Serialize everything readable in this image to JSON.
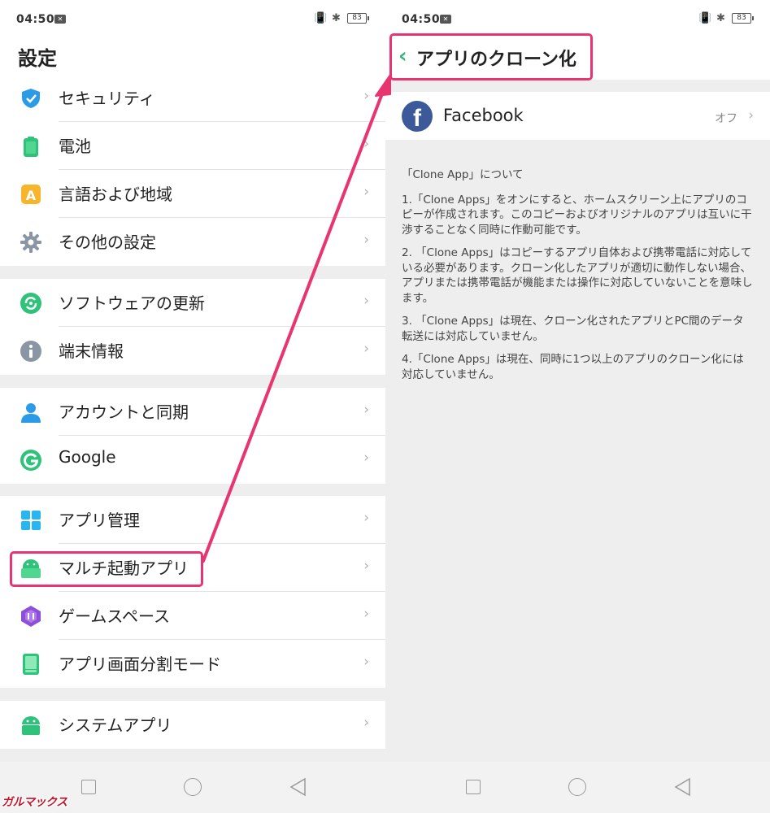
{
  "left": {
    "status": {
      "time": "04:50",
      "battery": "83"
    },
    "title": "設定",
    "sections": [
      {
        "items": [
          {
            "label": "セキュリティ",
            "icon": "shield-icon"
          },
          {
            "label": "電池",
            "icon": "battery-icon"
          },
          {
            "label": "言語および地域",
            "icon": "language-icon"
          },
          {
            "label": "その他の設定",
            "icon": "gear-icon"
          }
        ]
      },
      {
        "items": [
          {
            "label": "ソフトウェアの更新",
            "icon": "update-icon"
          },
          {
            "label": "端末情報",
            "icon": "info-icon"
          }
        ]
      },
      {
        "items": [
          {
            "label": "アカウントと同期",
            "icon": "account-icon"
          },
          {
            "label": "Google",
            "icon": "google-icon"
          }
        ]
      },
      {
        "items": [
          {
            "label": "アプリ管理",
            "icon": "app-grid-icon"
          },
          {
            "label": "マルチ起動アプリ",
            "icon": "android-clone-icon"
          },
          {
            "label": "ゲームスペース",
            "icon": "game-space-icon"
          },
          {
            "label": "アプリ画面分割モード",
            "icon": "split-screen-icon"
          }
        ]
      },
      {
        "items": [
          {
            "label": "システムアプリ",
            "icon": "android-icon"
          }
        ]
      }
    ],
    "chevron": "›"
  },
  "right": {
    "status": {
      "time": "04:50",
      "battery": "83"
    },
    "title": "アプリのクローン化",
    "back_glyph": "‹",
    "app": {
      "name": "Facebook",
      "state": "オフ",
      "icon": "facebook-icon",
      "icon_glyph": "f"
    },
    "info_heading": "「Clone App」について",
    "info_paragraphs": [
      "1.「Clone Apps」をオンにすると、ホームスクリーン上にアプリのコピーが作成されます。このコピーおよびオリジナルのアプリは互いに干渉することなく同時に作動可能です。",
      "2. 「Clone Apps」はコピーするアプリ自体および携帯電話に対応している必要があります。クローン化したアプリが適切に動作しない場合、アプリまたは携帯電話が機能または操作に対応していないことを意味します。",
      "3. 「Clone Apps」は現在、クローン化されたアプリとPC間のデータ転送には対応していません。",
      "4.「Clone Apps」は現在、同時に1つ以上のアプリのクローン化には対応していません。"
    ]
  },
  "watermark": "ガルマックス",
  "colors": {
    "highlight": "#e8356f",
    "accent_green": "#36b37e",
    "facebook_blue": "#3c5a9a"
  }
}
